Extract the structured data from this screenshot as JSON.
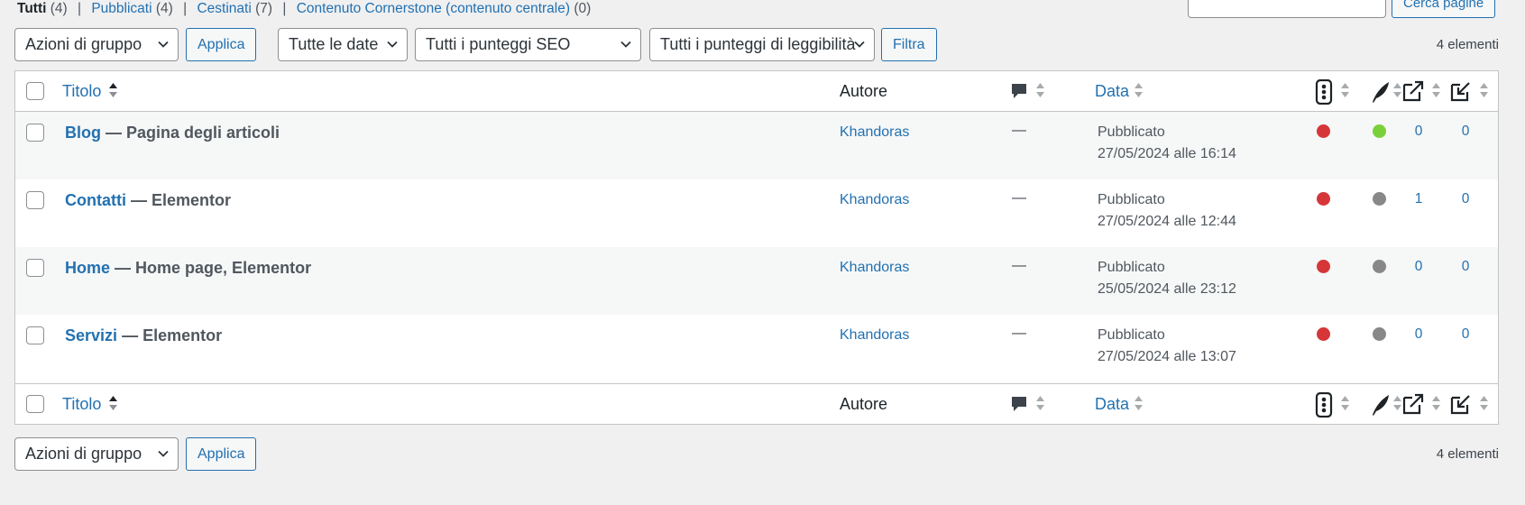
{
  "status_links": [
    {
      "label": "Tutti",
      "count": "(4)",
      "current": true
    },
    {
      "label": "Pubblicati",
      "count": "(4)",
      "current": false
    },
    {
      "label": "Cestinati",
      "count": "(7)",
      "current": false
    },
    {
      "label": "Contenuto Cornerstone (contenuto centrale)",
      "count": "(0)",
      "current": false
    }
  ],
  "search": {
    "button_label": "Cerca pagine"
  },
  "top_controls": {
    "bulk_actions": "Azioni di gruppo",
    "apply": "Applica",
    "date_filter": "Tutte le date",
    "seo_filter": "Tutti i punteggi SEO",
    "readability_filter": "Tutti i punteggi di leggibilità",
    "filter_button": "Filtra",
    "item_count": "4 elementi"
  },
  "columns": {
    "title": "Titolo",
    "author": "Autore",
    "date": "Data"
  },
  "rows": [
    {
      "title": "Blog",
      "state": "— Pagina degli articoli",
      "author": "Khandoras",
      "comments": "—",
      "status": "Pubblicato",
      "date": "27/05/2024 alle 16:14",
      "seo": "#d63638",
      "readability": "#7ad03a",
      "links_out": "0",
      "links_in": "0"
    },
    {
      "title": "Contatti",
      "state": "— Elementor",
      "author": "Khandoras",
      "comments": "—",
      "status": "Pubblicato",
      "date": "27/05/2024 alle 12:44",
      "seo": "#d63638",
      "readability": "#888888",
      "links_out": "1",
      "links_in": "0"
    },
    {
      "title": "Home",
      "state": "— Home page, Elementor",
      "author": "Khandoras",
      "comments": "—",
      "status": "Pubblicato",
      "date": "25/05/2024 alle 23:12",
      "seo": "#d63638",
      "readability": "#888888",
      "links_out": "0",
      "links_in": "0"
    },
    {
      "title": "Servizi",
      "state": "— Elementor",
      "author": "Khandoras",
      "comments": "—",
      "status": "Pubblicato",
      "date": "27/05/2024 alle 13:07",
      "seo": "#d63638",
      "readability": "#888888",
      "links_out": "0",
      "links_in": "0"
    }
  ],
  "bottom_controls": {
    "bulk_actions": "Azioni di gruppo",
    "apply": "Applica",
    "item_count": "4 elementi"
  },
  "icons": {
    "comments": "comment-bubble-icon",
    "seo": "seo-score-icon",
    "readability": "readability-feather-icon",
    "links_out": "outgoing-links-icon",
    "links_in": "incoming-links-icon"
  }
}
